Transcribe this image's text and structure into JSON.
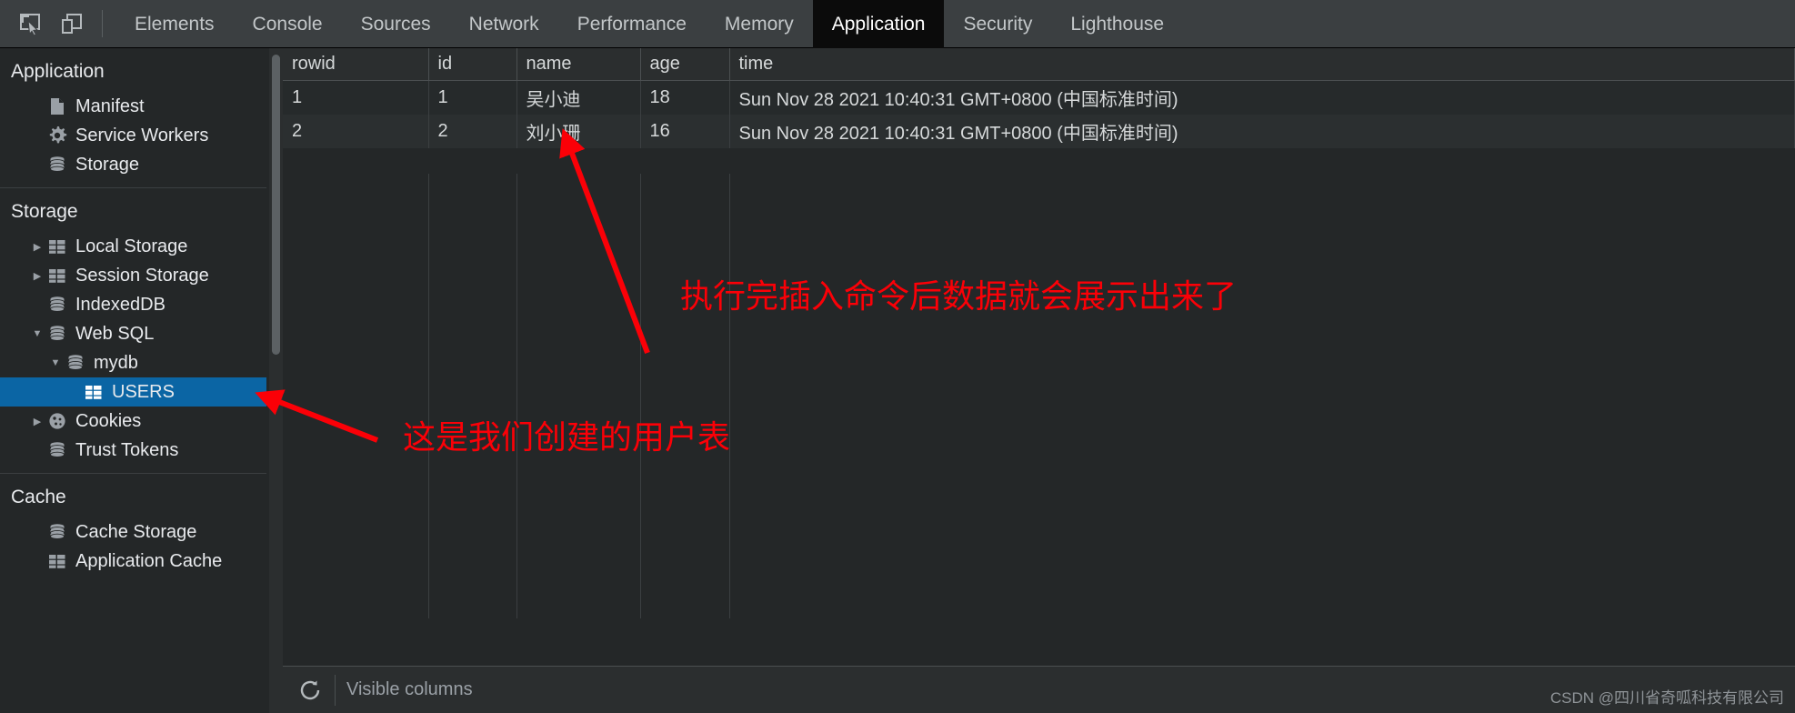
{
  "devtools": {
    "toolbar_icons": [
      {
        "name": "inspect-element-icon",
        "label": "Inspect element"
      },
      {
        "name": "device-toolbar-icon",
        "label": "Toggle device toolbar"
      }
    ],
    "tabs": [
      {
        "label": "Elements",
        "active": false
      },
      {
        "label": "Console",
        "active": false
      },
      {
        "label": "Sources",
        "active": false
      },
      {
        "label": "Network",
        "active": false
      },
      {
        "label": "Performance",
        "active": false
      },
      {
        "label": "Memory",
        "active": false
      },
      {
        "label": "Application",
        "active": true
      },
      {
        "label": "Security",
        "active": false
      },
      {
        "label": "Lighthouse",
        "active": false
      }
    ]
  },
  "sidebar": {
    "sections": [
      {
        "header": "Application",
        "items": [
          {
            "label": "Manifest",
            "icon": "document-icon",
            "indent": 1,
            "twisty": "none",
            "selected": false
          },
          {
            "label": "Service Workers",
            "icon": "gear-icon",
            "indent": 1,
            "twisty": "none",
            "selected": false
          },
          {
            "label": "Storage",
            "icon": "database-icon",
            "indent": 1,
            "twisty": "none",
            "selected": false
          }
        ]
      },
      {
        "header": "Storage",
        "items": [
          {
            "label": "Local Storage",
            "icon": "table-icon",
            "indent": 1,
            "twisty": "collapsed",
            "selected": false
          },
          {
            "label": "Session Storage",
            "icon": "table-icon",
            "indent": 1,
            "twisty": "collapsed",
            "selected": false
          },
          {
            "label": "IndexedDB",
            "icon": "database-icon",
            "indent": 1,
            "twisty": "none",
            "selected": false
          },
          {
            "label": "Web SQL",
            "icon": "database-icon",
            "indent": 1,
            "twisty": "expanded",
            "selected": false
          },
          {
            "label": "mydb",
            "icon": "database-icon",
            "indent": 2,
            "twisty": "expanded",
            "selected": false
          },
          {
            "label": "USERS",
            "icon": "table-icon",
            "indent": 3,
            "twisty": "none",
            "selected": true
          },
          {
            "label": "Cookies",
            "icon": "cookie-icon",
            "indent": 1,
            "twisty": "collapsed",
            "selected": false
          },
          {
            "label": "Trust Tokens",
            "icon": "database-icon",
            "indent": 1,
            "twisty": "none",
            "selected": false
          }
        ]
      },
      {
        "header": "Cache",
        "items": [
          {
            "label": "Cache Storage",
            "icon": "database-icon",
            "indent": 1,
            "twisty": "none",
            "selected": false
          },
          {
            "label": "Application Cache",
            "icon": "table-icon",
            "indent": 1,
            "twisty": "none",
            "selected": false
          }
        ]
      }
    ]
  },
  "table": {
    "columns": [
      "rowid",
      "id",
      "name",
      "age",
      "time"
    ],
    "rows": [
      [
        "1",
        "1",
        "吴小迪",
        "18",
        "Sun Nov 28 2021 10:40:31 GMT+0800 (中国标准时间)"
      ],
      [
        "2",
        "2",
        "刘小珊",
        "16",
        "Sun Nov 28 2021 10:40:31 GMT+0800 (中国标准时间)"
      ]
    ]
  },
  "bottom_toolbar": {
    "refresh_icon": "refresh-icon",
    "visible_columns_placeholder": "Visible columns",
    "visible_columns_value": ""
  },
  "annotations": {
    "top_note": "执行完插入命令后数据就会展示出来了",
    "bottom_note": "这是我们创建的用户表",
    "color": "#fb0007"
  },
  "watermark": "CSDN @四川省奇呱科技有限公司",
  "colors": {
    "selection_blue": "#0b65a4",
    "tabbar_bg": "#3b3f41",
    "active_tab_bg": "#0b0b0b",
    "panel_bg": "#242728",
    "annotation_red": "#fb0007"
  }
}
